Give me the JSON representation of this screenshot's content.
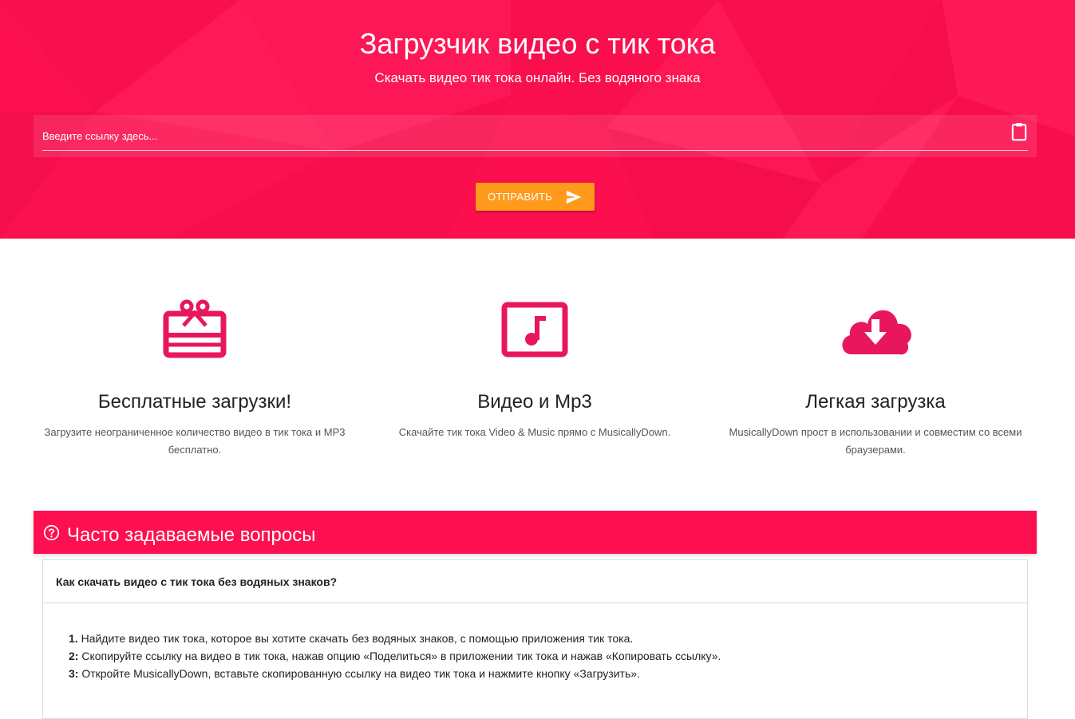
{
  "hero": {
    "title": "Загрузчик видео с тик тока",
    "subtitle": "Скачать видео тик тока онлайн. Без водяного знака",
    "input_placeholder": "Введите ссылку здесь...",
    "input_value": "",
    "paste_icon": "clipboard-icon",
    "submit_label": "ОТПРАВИТЬ",
    "submit_icon": "send-icon"
  },
  "features": [
    {
      "icon": "gift-card-icon",
      "title": "Бесплатные загрузки!",
      "text": "Загрузите неограниченное количество видео в тик тока и MP3 бесплатно."
    },
    {
      "icon": "music-note-box-icon",
      "title": "Видео и Mp3",
      "text": "Скачайте тик тока Video & Music прямо с MusicallyDown."
    },
    {
      "icon": "cloud-download-icon",
      "title": "Легкая загрузка",
      "text": "MusicallyDown прост в использовании и совместим со всеми браузерами."
    }
  ],
  "faq": {
    "icon": "question-circle-icon",
    "title": "Часто задаваемые вопросы",
    "items": [
      {
        "question": "Как скачать видео с тик тока без водяных знаков?",
        "steps": [
          {
            "num": "1.",
            "text": "Найдите видео тик тока, которое вы хотите скачать без водяных знаков, с помощью приложения тик тока."
          },
          {
            "num": "2:",
            "text": "Скопируйте ссылку на видео в тик тока, нажав опцию «Поделиться» в приложении тик тока и нажав «Копировать ссылку»."
          },
          {
            "num": "3:",
            "text": "Откройте MusicallyDown, вставьте скопированную ссылку на видео тик тока и нажмите кнопку «Загрузить»."
          }
        ]
      }
    ]
  },
  "colors": {
    "brand_pink": "#fd1050",
    "icon_pink": "#e8175d",
    "button_orange": "#ff9a1c"
  }
}
